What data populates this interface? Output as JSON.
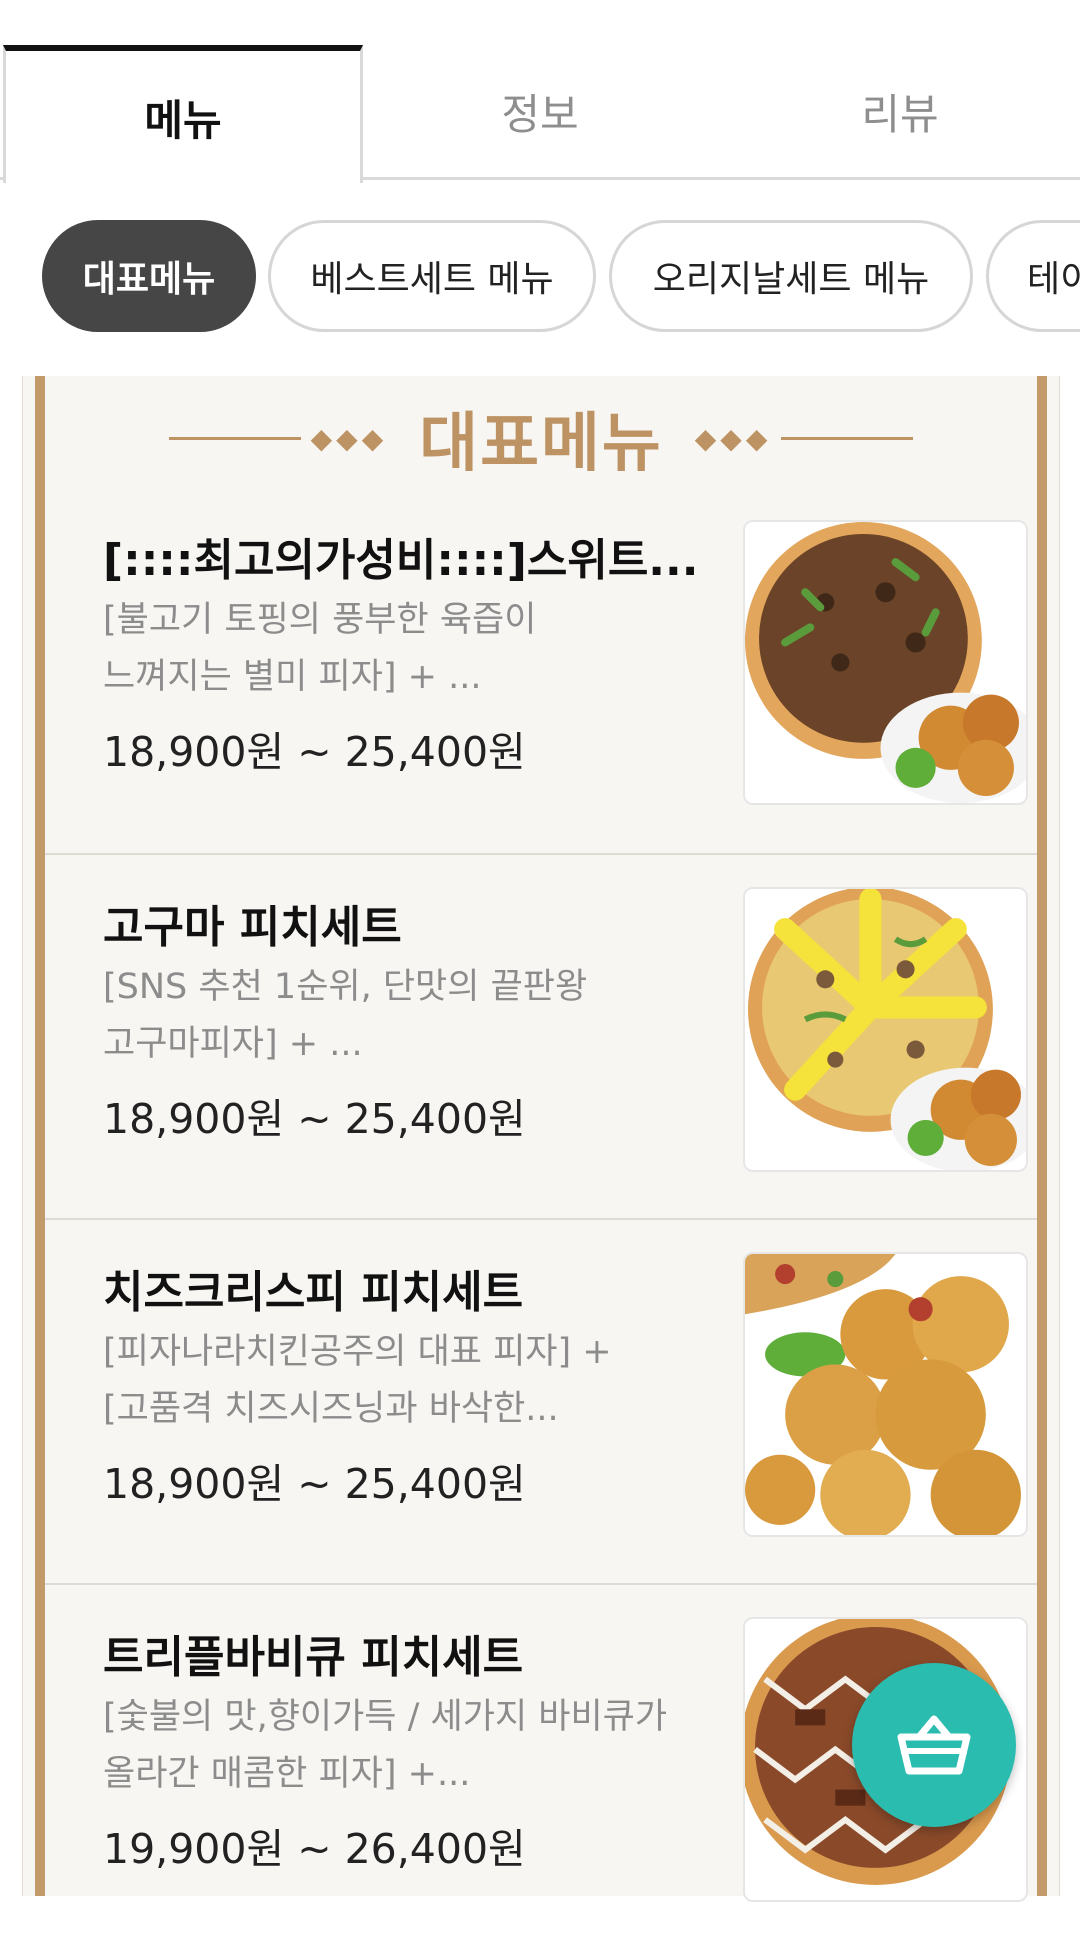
{
  "tabs": [
    {
      "label": "메뉴",
      "active": true
    },
    {
      "label": "정보",
      "active": false
    },
    {
      "label": "리뷰",
      "active": false
    }
  ],
  "categories": [
    {
      "label": "대표메뉴",
      "active": true
    },
    {
      "label": "베스트세트 메뉴",
      "active": false
    },
    {
      "label": "오리지날세트 메뉴",
      "active": false
    },
    {
      "label": "테이",
      "active": false
    }
  ],
  "section": {
    "title": "대표메뉴"
  },
  "menu_items": [
    {
      "name": "[::::최고의가성비::::]스위트...",
      "desc_line1": "[불고기 토핑의 풍부한 육즙이",
      "desc_line2": "느껴지는 별미 피자] + ...",
      "price": "18,900원 ~ 25,400원"
    },
    {
      "name": "고구마 피치세트",
      "desc_line1": "[SNS 추천 1순위, 단맛의 끝판왕",
      "desc_line2": "고구마피자] + ...",
      "price": "18,900원 ~ 25,400원"
    },
    {
      "name": "치즈크리스피 피치세트",
      "desc_line1": "[피자나라치킨공주의 대표 피자] +",
      "desc_line2": "[고품격 치즈시즈닝과 바삭한...",
      "price": "18,900원 ~ 25,400원"
    },
    {
      "name": "트리플바비큐 피치세트",
      "desc_line1": "[숯불의 맛,향이가득 / 세가지 바비큐가",
      "desc_line2": "올라간 매콤한 피자] +...",
      "price": "19,900원 ~ 26,400원"
    }
  ],
  "colors": {
    "accent_gold": "#bd9364",
    "chip_active": "#464646",
    "fab": "#2bbcb0"
  },
  "icons": {
    "cart": "shopping-basket-icon"
  }
}
